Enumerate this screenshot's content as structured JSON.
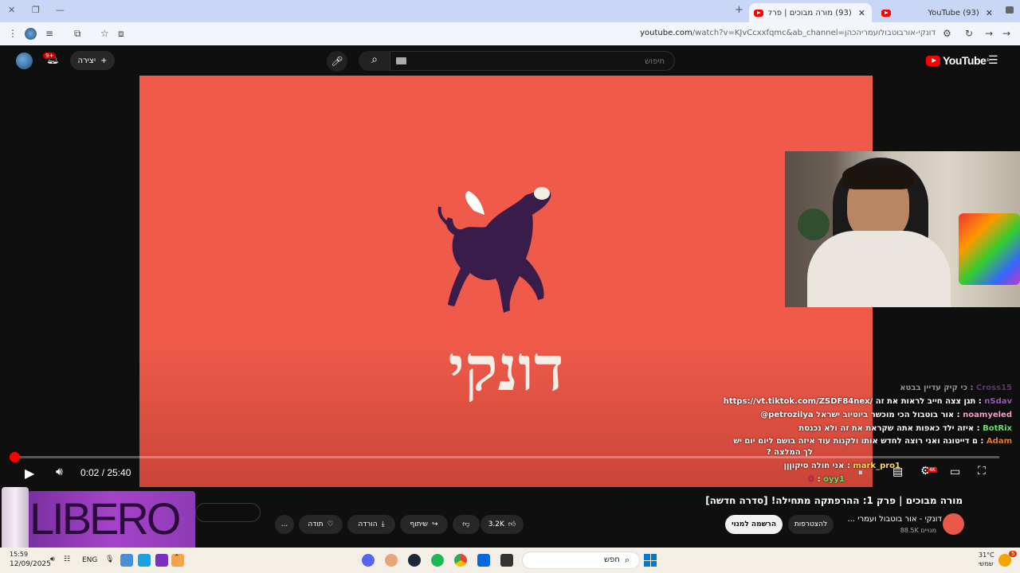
{
  "browser": {
    "tabs": [
      {
        "title": "(93) מורה מבוכים | פרק 1: ההרפתקה",
        "active": true
      },
      {
        "title": "(93) YouTube",
        "active": false
      }
    ],
    "url_host": "youtube.com",
    "url_path": "/watch?v=KJvCcxxfqmc&ab_channel=דונקי-אורבוטבולועמריהכהן",
    "new_tab": "+"
  },
  "youtube_header": {
    "logo_text": "YouTube",
    "logo_region": "IL",
    "search_placeholder": "חיפוש",
    "create_label": "יצירה",
    "notification_count": "9+"
  },
  "video": {
    "logo_text": "דונקי",
    "time_current": "0:02",
    "time_total": "25:40",
    "time_sep": " / ",
    "progress_fraction": 0.0013,
    "quality_badge": "4K"
  },
  "chat": [
    {
      "name": "Cross15",
      "text": "כי קיק עדיין בבטא",
      "color": "#9b59b6"
    },
    {
      "name": "nSdav",
      "text": "https://vt.tiktok.com/ZSDF84nex/ תגן צצה חייב לראות את זה",
      "color": "#9b59b6"
    },
    {
      "name": "noamyeled",
      "text": "@petrozilya אור בוטבול הכי מוכשר ביוטיוב ישראל",
      "color": "#ff99cc"
    },
    {
      "name": "BotRix",
      "text": "איזה ילד כאפות אתה שקראת את זה ולא נכנסת",
      "color": "#6ae06a"
    },
    {
      "name": "Adam",
      "text": "ם דייטונה ואני רוצה לחדש אותו ולקנות עוד איזה בושם ליום יום יש",
      "color": "#e67e22"
    },
    {
      "name": "",
      "text": "? לך המלצה",
      "color": "#ffffff"
    },
    {
      "name": "mark_pro1",
      "text": "אני חולה סיקוןןן",
      "color": "#ffd84d"
    },
    {
      "name": "oyy1",
      "text": "",
      "color": "#ffffff"
    },
    {
      "name": "oyy1",
      "text": "",
      "color": "#ffffff"
    }
  ],
  "below_video": {
    "title": "מורה מבוכים | פרק 1: ההרפתקה מתחילה! [סדרה חדשה]",
    "channel_name": "דונקי - אור בוטבול ועמרי ...",
    "channel_subs": "88.5K מנויים",
    "subscribe_label": "הרשמה למנוי",
    "join_label": "להצטרפות",
    "like_count": "3.2K",
    "share_label": "שיתוף",
    "download_label": "הורדה",
    "thanks_label": "תודה",
    "more_label": "..."
  },
  "overlay": {
    "brand_text": "LIBERO"
  },
  "taskbar": {
    "search_placeholder": "חפש",
    "weather_temp": "31°C",
    "weather_desc": "שמשי",
    "language": "ENG",
    "date": "12/09/2025",
    "time": "15:59",
    "notif_count": "5"
  },
  "colors": {
    "youtube_red": "#ff0000",
    "video_bg": "#f05a4a",
    "taskbar_bg": "#f3eee6"
  }
}
